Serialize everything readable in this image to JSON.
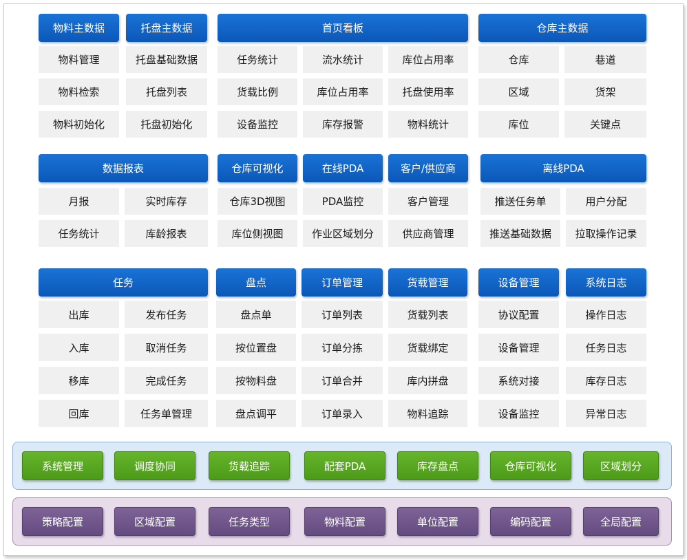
{
  "colors": {
    "header_blue": "#0b63c7",
    "cell_gray": "#f0f0f0",
    "band_blue": "#dceaf7",
    "band_purple": "#e8dcea",
    "button_green": "#5aa820",
    "button_purple": "#6f5589"
  },
  "modules": {
    "material": {
      "title": "物料主数据",
      "items": [
        "物料管理",
        "物料检索",
        "物料初始化"
      ]
    },
    "pallet": {
      "title": "托盘主数据",
      "items": [
        "托盘基础数据",
        "托盘列表",
        "托盘初始化"
      ]
    },
    "dashboard": {
      "title": "首页看板",
      "items": [
        "任务统计",
        "流水统计",
        "库位占用率",
        "货载比例",
        "库位占用率",
        "托盘使用率",
        "设备监控",
        "库存报警",
        "物料统计"
      ]
    },
    "warehouse": {
      "title": "仓库主数据",
      "items": [
        "仓库",
        "巷道",
        "区域",
        "货架",
        "库位",
        "关键点"
      ]
    },
    "reports": {
      "title": "数据报表",
      "items": [
        "月报",
        "实时库存",
        "任务统计",
        "库龄报表"
      ]
    },
    "visual": {
      "title": "仓库可视化",
      "items": [
        "仓库3D视图",
        "库位侧视图"
      ]
    },
    "online_pda": {
      "title": "在线PDA",
      "items": [
        "PDA监控",
        "作业区域划分"
      ]
    },
    "partner": {
      "title": "客户/供应商",
      "items": [
        "客户管理",
        "供应商管理"
      ]
    },
    "offline_pda": {
      "title": "离线PDA",
      "items": [
        "推送任务单",
        "用户分配",
        "推送基础数据",
        "拉取操作记录"
      ]
    },
    "task": {
      "title": "任务",
      "items": [
        "出库",
        "发布任务",
        "入库",
        "取消任务",
        "移库",
        "完成任务",
        "回库",
        "任务单管理"
      ]
    },
    "inventory": {
      "title": "盘点",
      "items": [
        "盘点单",
        "按位置盘",
        "按物料盘",
        "盘点调平"
      ]
    },
    "order": {
      "title": "订单管理",
      "items": [
        "订单列表",
        "订单分拣",
        "订单合并",
        "订单录入"
      ]
    },
    "cargo": {
      "title": "货载管理",
      "items": [
        "货载列表",
        "货载绑定",
        "库内拼盘",
        "物料追踪"
      ]
    },
    "device": {
      "title": "设备管理",
      "items": [
        "协议配置",
        "设备管理",
        "系统对接",
        "设备监控"
      ]
    },
    "syslog": {
      "title": "系统日志",
      "items": [
        "操作日志",
        "任务日志",
        "库存日志",
        "异常日志"
      ]
    }
  },
  "features_band": [
    "系统管理",
    "调度协同",
    "货载追踪",
    "配套PDA",
    "库存盘点",
    "仓库可视化",
    "区域划分"
  ],
  "config_band": [
    "策略配置",
    "区域配置",
    "任务类型",
    "物料配置",
    "单位配置",
    "编码配置",
    "全局配置"
  ]
}
